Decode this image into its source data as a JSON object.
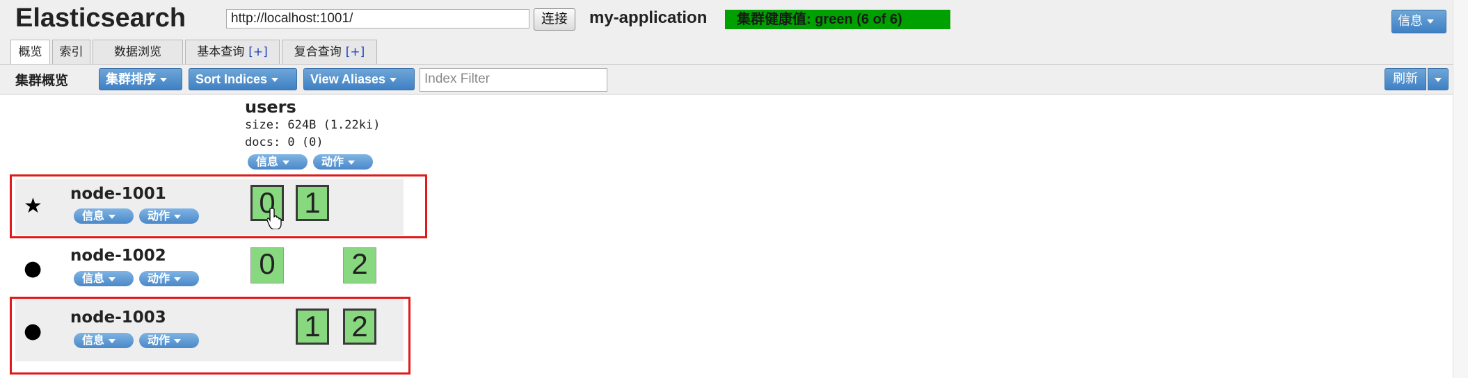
{
  "header": {
    "logo": "Elasticsearch",
    "url": "http://localhost:1001/",
    "connect_label": "连接",
    "cluster_name": "my-application",
    "health": "集群健康值: green (6 of 6)",
    "info_label": "信息"
  },
  "tabs": [
    {
      "label": "概览"
    },
    {
      "label": "索引"
    },
    {
      "label": "数据浏览"
    },
    {
      "label": "基本查询",
      "plus": "[+]"
    },
    {
      "label": "复合查询",
      "plus": "[+]"
    }
  ],
  "toolbar": {
    "title": "集群概览",
    "sort_cluster": "集群排序",
    "sort_indices": "Sort Indices",
    "view_aliases": "View Aliases",
    "filter_placeholder": "Index Filter",
    "refresh": "刷新"
  },
  "index": {
    "name": "users",
    "size": "size: 624B (1.22ki)",
    "docs": "docs: 0 (0)",
    "info": "信息",
    "action": "动作"
  },
  "nodes": [
    {
      "name": "node-1001",
      "marker": "★",
      "info": "信息",
      "action": "动作",
      "shards": [
        "0",
        "1"
      ]
    },
    {
      "name": "node-1002",
      "marker": "●",
      "info": "信息",
      "action": "动作",
      "shards": [
        "0",
        "2"
      ]
    },
    {
      "name": "node-1003",
      "marker": "●",
      "info": "信息",
      "action": "动作",
      "shards": [
        "1",
        "2"
      ]
    }
  ],
  "colors": {
    "health_green": "#00a000",
    "shard_green": "#87d87f",
    "highlight_red": "#e01a1a",
    "button_blue": "#4a88c8"
  }
}
